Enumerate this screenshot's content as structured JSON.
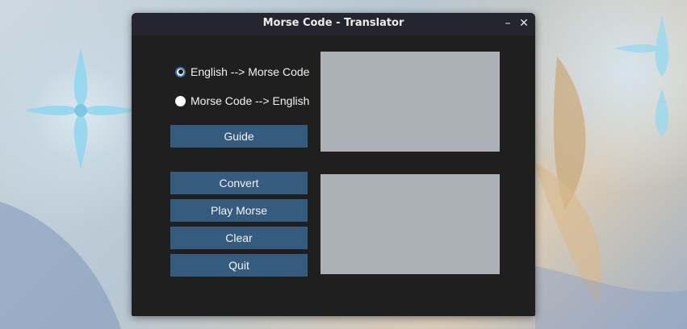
{
  "window": {
    "title": "Morse Code - Translator",
    "minimize_glyph": "–",
    "close_glyph": "✕"
  },
  "mode_options": [
    {
      "label": "English --> Morse Code",
      "selected": true
    },
    {
      "label": "Morse Code --> English",
      "selected": false
    }
  ],
  "buttons": {
    "guide": "Guide",
    "convert": "Convert",
    "play_morse": "Play Morse",
    "clear": "Clear",
    "quit": "Quit"
  },
  "input_box": {
    "value": ""
  },
  "output_box": {
    "value": ""
  },
  "colors": {
    "window_bg": "#1f1f1f",
    "titlebar_bg": "#252530",
    "button_bg": "#355b7e",
    "textbox_bg": "#acb1b7"
  }
}
